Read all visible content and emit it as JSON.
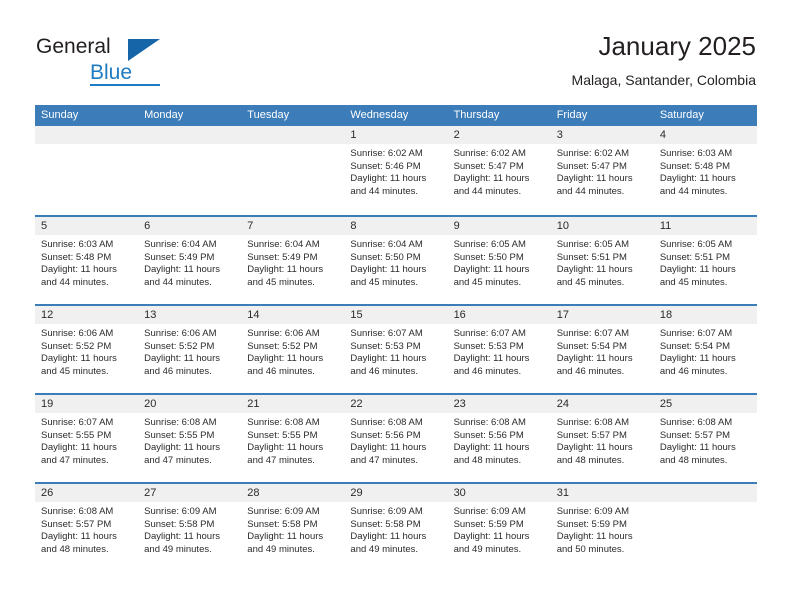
{
  "brand": {
    "name_part1": "General",
    "name_part2": "Blue",
    "triangle_color": "#1565a8",
    "blue_color": "#1f7bc1"
  },
  "header": {
    "title": "January 2025",
    "subtitle": "Malaga, Santander, Colombia"
  },
  "theme": {
    "header_band": "#3b7cb9",
    "day_band": "#f0f0f0",
    "text": "#2b2b2b"
  },
  "calendar": {
    "weekdays": [
      "Sunday",
      "Monday",
      "Tuesday",
      "Wednesday",
      "Thursday",
      "Friday",
      "Saturday"
    ],
    "weeks": [
      [
        {
          "day": "",
          "sunrise": "",
          "sunset": "",
          "daylight_line1": "",
          "daylight_line2": ""
        },
        {
          "day": "",
          "sunrise": "",
          "sunset": "",
          "daylight_line1": "",
          "daylight_line2": ""
        },
        {
          "day": "",
          "sunrise": "",
          "sunset": "",
          "daylight_line1": "",
          "daylight_line2": ""
        },
        {
          "day": "1",
          "sunrise": "Sunrise: 6:02 AM",
          "sunset": "Sunset: 5:46 PM",
          "daylight_line1": "Daylight: 11 hours",
          "daylight_line2": "and 44 minutes."
        },
        {
          "day": "2",
          "sunrise": "Sunrise: 6:02 AM",
          "sunset": "Sunset: 5:47 PM",
          "daylight_line1": "Daylight: 11 hours",
          "daylight_line2": "and 44 minutes."
        },
        {
          "day": "3",
          "sunrise": "Sunrise: 6:02 AM",
          "sunset": "Sunset: 5:47 PM",
          "daylight_line1": "Daylight: 11 hours",
          "daylight_line2": "and 44 minutes."
        },
        {
          "day": "4",
          "sunrise": "Sunrise: 6:03 AM",
          "sunset": "Sunset: 5:48 PM",
          "daylight_line1": "Daylight: 11 hours",
          "daylight_line2": "and 44 minutes."
        }
      ],
      [
        {
          "day": "5",
          "sunrise": "Sunrise: 6:03 AM",
          "sunset": "Sunset: 5:48 PM",
          "daylight_line1": "Daylight: 11 hours",
          "daylight_line2": "and 44 minutes."
        },
        {
          "day": "6",
          "sunrise": "Sunrise: 6:04 AM",
          "sunset": "Sunset: 5:49 PM",
          "daylight_line1": "Daylight: 11 hours",
          "daylight_line2": "and 44 minutes."
        },
        {
          "day": "7",
          "sunrise": "Sunrise: 6:04 AM",
          "sunset": "Sunset: 5:49 PM",
          "daylight_line1": "Daylight: 11 hours",
          "daylight_line2": "and 45 minutes."
        },
        {
          "day": "8",
          "sunrise": "Sunrise: 6:04 AM",
          "sunset": "Sunset: 5:50 PM",
          "daylight_line1": "Daylight: 11 hours",
          "daylight_line2": "and 45 minutes."
        },
        {
          "day": "9",
          "sunrise": "Sunrise: 6:05 AM",
          "sunset": "Sunset: 5:50 PM",
          "daylight_line1": "Daylight: 11 hours",
          "daylight_line2": "and 45 minutes."
        },
        {
          "day": "10",
          "sunrise": "Sunrise: 6:05 AM",
          "sunset": "Sunset: 5:51 PM",
          "daylight_line1": "Daylight: 11 hours",
          "daylight_line2": "and 45 minutes."
        },
        {
          "day": "11",
          "sunrise": "Sunrise: 6:05 AM",
          "sunset": "Sunset: 5:51 PM",
          "daylight_line1": "Daylight: 11 hours",
          "daylight_line2": "and 45 minutes."
        }
      ],
      [
        {
          "day": "12",
          "sunrise": "Sunrise: 6:06 AM",
          "sunset": "Sunset: 5:52 PM",
          "daylight_line1": "Daylight: 11 hours",
          "daylight_line2": "and 45 minutes."
        },
        {
          "day": "13",
          "sunrise": "Sunrise: 6:06 AM",
          "sunset": "Sunset: 5:52 PM",
          "daylight_line1": "Daylight: 11 hours",
          "daylight_line2": "and 46 minutes."
        },
        {
          "day": "14",
          "sunrise": "Sunrise: 6:06 AM",
          "sunset": "Sunset: 5:52 PM",
          "daylight_line1": "Daylight: 11 hours",
          "daylight_line2": "and 46 minutes."
        },
        {
          "day": "15",
          "sunrise": "Sunrise: 6:07 AM",
          "sunset": "Sunset: 5:53 PM",
          "daylight_line1": "Daylight: 11 hours",
          "daylight_line2": "and 46 minutes."
        },
        {
          "day": "16",
          "sunrise": "Sunrise: 6:07 AM",
          "sunset": "Sunset: 5:53 PM",
          "daylight_line1": "Daylight: 11 hours",
          "daylight_line2": "and 46 minutes."
        },
        {
          "day": "17",
          "sunrise": "Sunrise: 6:07 AM",
          "sunset": "Sunset: 5:54 PM",
          "daylight_line1": "Daylight: 11 hours",
          "daylight_line2": "and 46 minutes."
        },
        {
          "day": "18",
          "sunrise": "Sunrise: 6:07 AM",
          "sunset": "Sunset: 5:54 PM",
          "daylight_line1": "Daylight: 11 hours",
          "daylight_line2": "and 46 minutes."
        }
      ],
      [
        {
          "day": "19",
          "sunrise": "Sunrise: 6:07 AM",
          "sunset": "Sunset: 5:55 PM",
          "daylight_line1": "Daylight: 11 hours",
          "daylight_line2": "and 47 minutes."
        },
        {
          "day": "20",
          "sunrise": "Sunrise: 6:08 AM",
          "sunset": "Sunset: 5:55 PM",
          "daylight_line1": "Daylight: 11 hours",
          "daylight_line2": "and 47 minutes."
        },
        {
          "day": "21",
          "sunrise": "Sunrise: 6:08 AM",
          "sunset": "Sunset: 5:55 PM",
          "daylight_line1": "Daylight: 11 hours",
          "daylight_line2": "and 47 minutes."
        },
        {
          "day": "22",
          "sunrise": "Sunrise: 6:08 AM",
          "sunset": "Sunset: 5:56 PM",
          "daylight_line1": "Daylight: 11 hours",
          "daylight_line2": "and 47 minutes."
        },
        {
          "day": "23",
          "sunrise": "Sunrise: 6:08 AM",
          "sunset": "Sunset: 5:56 PM",
          "daylight_line1": "Daylight: 11 hours",
          "daylight_line2": "and 48 minutes."
        },
        {
          "day": "24",
          "sunrise": "Sunrise: 6:08 AM",
          "sunset": "Sunset: 5:57 PM",
          "daylight_line1": "Daylight: 11 hours",
          "daylight_line2": "and 48 minutes."
        },
        {
          "day": "25",
          "sunrise": "Sunrise: 6:08 AM",
          "sunset": "Sunset: 5:57 PM",
          "daylight_line1": "Daylight: 11 hours",
          "daylight_line2": "and 48 minutes."
        }
      ],
      [
        {
          "day": "26",
          "sunrise": "Sunrise: 6:08 AM",
          "sunset": "Sunset: 5:57 PM",
          "daylight_line1": "Daylight: 11 hours",
          "daylight_line2": "and 48 minutes."
        },
        {
          "day": "27",
          "sunrise": "Sunrise: 6:09 AM",
          "sunset": "Sunset: 5:58 PM",
          "daylight_line1": "Daylight: 11 hours",
          "daylight_line2": "and 49 minutes."
        },
        {
          "day": "28",
          "sunrise": "Sunrise: 6:09 AM",
          "sunset": "Sunset: 5:58 PM",
          "daylight_line1": "Daylight: 11 hours",
          "daylight_line2": "and 49 minutes."
        },
        {
          "day": "29",
          "sunrise": "Sunrise: 6:09 AM",
          "sunset": "Sunset: 5:58 PM",
          "daylight_line1": "Daylight: 11 hours",
          "daylight_line2": "and 49 minutes."
        },
        {
          "day": "30",
          "sunrise": "Sunrise: 6:09 AM",
          "sunset": "Sunset: 5:59 PM",
          "daylight_line1": "Daylight: 11 hours",
          "daylight_line2": "and 49 minutes."
        },
        {
          "day": "31",
          "sunrise": "Sunrise: 6:09 AM",
          "sunset": "Sunset: 5:59 PM",
          "daylight_line1": "Daylight: 11 hours",
          "daylight_line2": "and 50 minutes."
        },
        {
          "day": "",
          "sunrise": "",
          "sunset": "",
          "daylight_line1": "",
          "daylight_line2": ""
        }
      ]
    ]
  }
}
